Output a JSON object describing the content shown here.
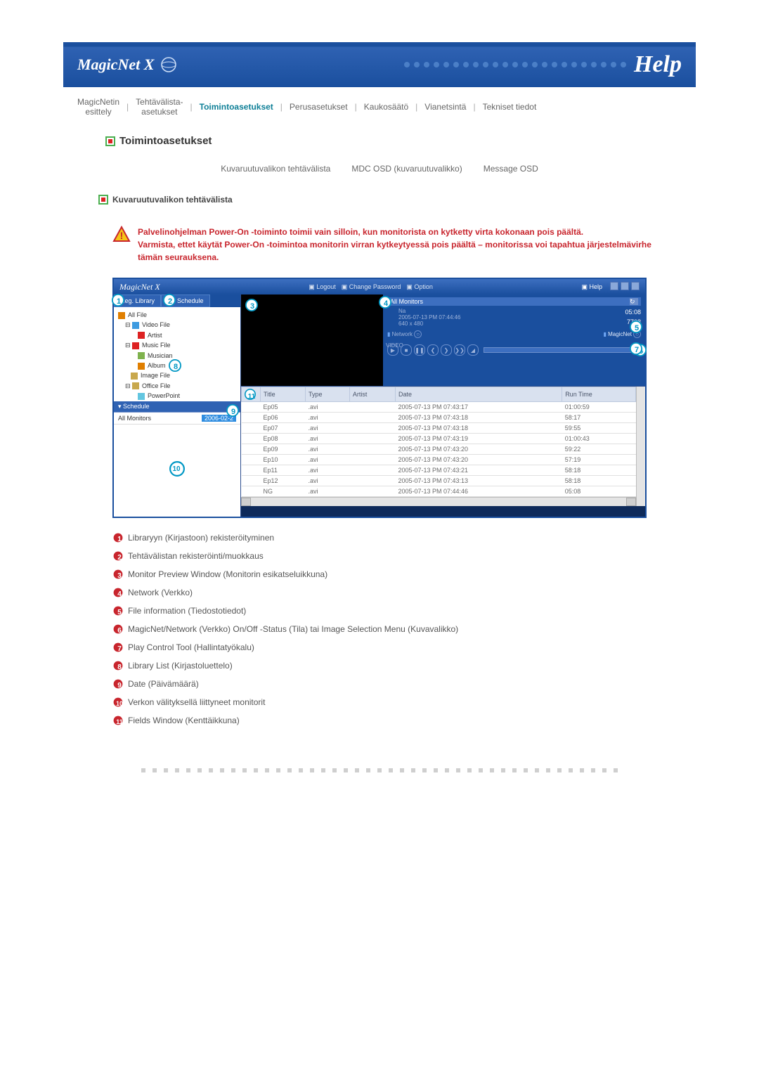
{
  "header": {
    "logo": "MagicNet X",
    "help": "Help"
  },
  "topnav": {
    "item1_l1": "MagicNetin",
    "item1_l2": "esittely",
    "item2_l1": "Tehtävälista-",
    "item2_l2": "asetukset",
    "item3": "Toimintoasetukset",
    "item4": "Perusasetukset",
    "item5": "Kaukosäätö",
    "item6": "Vianetsintä",
    "item7": "Tekniset tiedot"
  },
  "section_title": "Toimintoasetukset",
  "subtabs": {
    "t1": "Kuvaruutuvalikon tehtävälista",
    "t2": "MDC OSD (kuvaruutuvalikko)",
    "t3": "Message OSD"
  },
  "subsection": "Kuvaruutuvalikon tehtävälista",
  "warning": "Palvelinohjelman Power-On -toiminto toimii vain silloin, kun monitorista on kytketty virta kokonaan pois päältä.\nVarmista, ettet käytät Power-On -toimintoa monitorin virran kytkeytyessä pois päältä – monitorissa voi tapahtua järjestelmävirhe tämän seurauksena.",
  "mock": {
    "app_title": "MagicNet X",
    "menu": {
      "logout": "Logout",
      "changepw": "Change Password",
      "option": "Option",
      "help": "Help"
    },
    "tabs": {
      "lib": "Reg. Library",
      "sched": "Schedule"
    },
    "tree": {
      "allfile": "All File",
      "video": "Video File",
      "artist": "Artist",
      "music": "Music File",
      "musician": "Musician",
      "album": "Album",
      "image": "Image File",
      "office": "Office File",
      "ppt": "PowerPoint"
    },
    "schedule": {
      "hdr": "Schedule",
      "allmon": "All Monitors",
      "date": "2006-02-2"
    },
    "info": {
      "hdr": "All Monitors",
      "line_na": "Na",
      "line_ts": "2005-07-13 PM 07:44:46",
      "line_res": "640 x 480",
      "duration": "05:08",
      "size": "7708",
      "video": "VIDEO",
      "network": "Network",
      "magicnet": "MagicNet"
    },
    "columns": {
      "title": "Title",
      "type": "Type",
      "artist": "Artist",
      "date": "Date",
      "runtime": "Run Time"
    },
    "rows": [
      {
        "title": "Ep05",
        "type": ".avi",
        "artist": "",
        "date": "2005-07-13 PM 07:43:17",
        "rt": "01:00:59"
      },
      {
        "title": "Ep06",
        "type": ".avi",
        "artist": "",
        "date": "2005-07-13 PM 07:43:18",
        "rt": "58:17"
      },
      {
        "title": "Ep07",
        "type": ".avi",
        "artist": "",
        "date": "2005-07-13 PM 07:43:18",
        "rt": "59:55"
      },
      {
        "title": "Ep08",
        "type": ".avi",
        "artist": "",
        "date": "2005-07-13 PM 07:43:19",
        "rt": "01:00:43"
      },
      {
        "title": "Ep09",
        "type": ".avi",
        "artist": "",
        "date": "2005-07-13 PM 07:43:20",
        "rt": "59:22"
      },
      {
        "title": "Ep10",
        "type": ".avi",
        "artist": "",
        "date": "2005-07-13 PM 07:43:20",
        "rt": "57:19"
      },
      {
        "title": "Ep11",
        "type": ".avi",
        "artist": "",
        "date": "2005-07-13 PM 07:43:21",
        "rt": "58:18"
      },
      {
        "title": "Ep12",
        "type": ".avi",
        "artist": "",
        "date": "2005-07-13 PM 07:43:13",
        "rt": "58:18"
      },
      {
        "title": "NG",
        "type": ".avi",
        "artist": "",
        "date": "2005-07-13 PM 07:44:46",
        "rt": "05:08"
      }
    ]
  },
  "legend": {
    "1": "Libraryyn (Kirjastoon) rekisteröityminen",
    "2": "Tehtävälistan rekisteröinti/muokkaus",
    "3": "Monitor Preview Window (Monitorin esikatseluikkuna)",
    "4": "Network (Verkko)",
    "5": "File information (Tiedostotiedot)",
    "6": "MagicNet/Network (Verkko) On/Off -Status (Tila) tai Image Selection Menu (Kuvavalikko)",
    "7": "Play Control Tool (Hallintatyökalu)",
    "8": "Library List (Kirjastoluettelo)",
    "9": "Date (Päivämäärä)",
    "10": "Verkon välityksellä liittyneet monitorit",
    "11": "Fields Window (Kenttäikkuna)"
  }
}
